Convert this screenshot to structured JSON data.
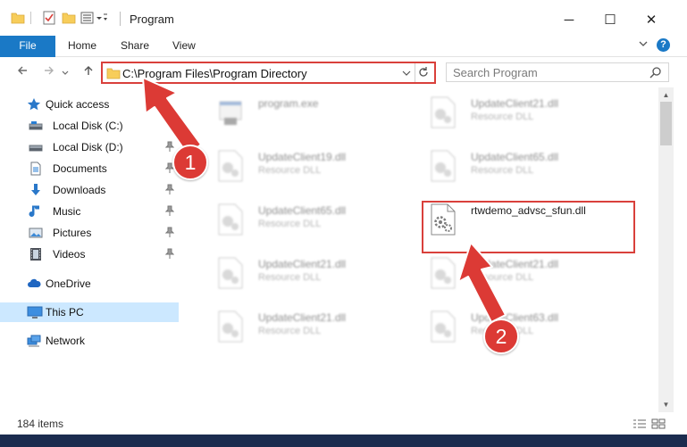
{
  "window": {
    "title": "Program",
    "controls": {
      "minimize": "─",
      "maximize": "☐",
      "close": "✕"
    }
  },
  "ribbon": {
    "tabs": [
      "File",
      "Home",
      "Share",
      "View"
    ],
    "expand_icon": "chevron-down-icon",
    "help_label": "?"
  },
  "nav": {
    "address": "C:\\Program Files\\Program Directory",
    "search_placeholder": "Search Program"
  },
  "sidebar": {
    "items": [
      {
        "label": "Quick access",
        "icon": "star-icon",
        "pinned": false
      },
      {
        "label": "Local Disk (C:)",
        "icon": "drive-icon",
        "pinned": false
      },
      {
        "label": "Local Disk (D:)",
        "icon": "drive-icon",
        "pinned": true
      },
      {
        "label": "Documents",
        "icon": "documents-icon",
        "pinned": true
      },
      {
        "label": "Downloads",
        "icon": "downloads-icon",
        "pinned": true
      },
      {
        "label": "Music",
        "icon": "music-icon",
        "pinned": true
      },
      {
        "label": "Pictures",
        "icon": "pictures-icon",
        "pinned": true
      },
      {
        "label": "Videos",
        "icon": "videos-icon",
        "pinned": true
      },
      {
        "label": "OneDrive",
        "icon": "cloud-icon",
        "pinned": false
      },
      {
        "label": "This PC",
        "icon": "computer-icon",
        "pinned": false,
        "selected": true
      },
      {
        "label": "Network",
        "icon": "network-icon",
        "pinned": false
      }
    ]
  },
  "files": [
    {
      "name": "program.exe",
      "type": "",
      "icon": "exe-icon",
      "blurred": true
    },
    {
      "name": "UpdateClient21.dll",
      "type": "Resource DLL",
      "icon": "dll-icon",
      "blurred": true
    },
    {
      "name": "UpdateClient19.dll",
      "type": "Resource DLL",
      "icon": "dll-icon",
      "blurred": true
    },
    {
      "name": "UpdateClient65.dll",
      "type": "Resource DLL",
      "icon": "dll-icon",
      "blurred": true
    },
    {
      "name": "UpdateClient65.dll",
      "type": "Resource DLL",
      "icon": "dll-icon",
      "blurred": true
    },
    {
      "name": "rtwdemo_advsc_sfun.dll",
      "type": "",
      "icon": "dll-icon",
      "blurred": false,
      "highlighted": true
    },
    {
      "name": "UpdateClient21.dll",
      "type": "Resource DLL",
      "icon": "dll-icon",
      "blurred": true
    },
    {
      "name": "UpdateClient21.dll",
      "type": "Resource DLL",
      "icon": "dll-icon",
      "blurred": true
    },
    {
      "name": "UpdateClient21.dll",
      "type": "Resource DLL",
      "icon": "dll-icon",
      "blurred": true
    },
    {
      "name": "UpdateClient63.dll",
      "type": "Resource DLL",
      "icon": "dll-icon",
      "blurred": true
    }
  ],
  "status": {
    "item_count": "184 items"
  },
  "annotations": {
    "step1": "1",
    "step2": "2",
    "color": "#dc3a35"
  }
}
